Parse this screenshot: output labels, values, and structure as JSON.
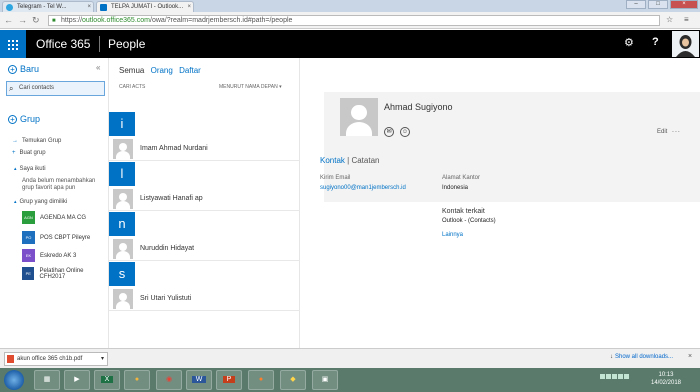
{
  "browser": {
    "tabs": [
      {
        "title": "Telegram - Tel W..."
      },
      {
        "title": "TELPA JUMATI - Outlook..."
      }
    ],
    "url_prefix": "https://",
    "url_host": "outlook.office365.com",
    "url_path": "/owa/?realm=madrjembersch.id#path=/people",
    "window_controls": {
      "minimize": "–",
      "maximize": "□",
      "close": "×"
    }
  },
  "o365": {
    "brand": "Office 365",
    "app": "People"
  },
  "leftnav": {
    "new_label": "Baru",
    "search_placeholder": "Cari contacts",
    "group_header": "Grup",
    "discover_groups": "Temukan Grup",
    "create_group": "Buat grup",
    "i_joined_header": "Saya ikuti",
    "hint": "Anda belum menambahkan grup favorit apa pun",
    "owned_header": "Grup yang dimiliki",
    "groups": [
      {
        "initials": "AGN",
        "name": "AGENDA MA CG",
        "color": "#2a9d3c"
      },
      {
        "initials": "PO",
        "name": "POS CBPT Pileyre",
        "color": "#1f6fbf"
      },
      {
        "initials": "EK",
        "name": "Eskredo AK 3",
        "color": "#7a4fc9"
      },
      {
        "initials": "PE",
        "name": "Pelatihan Online CFH2017",
        "color": "#1f4f8f"
      }
    ]
  },
  "list": {
    "filters": [
      "Semua",
      "Orang",
      "Daftar"
    ],
    "selected_filter": "Semua",
    "sub_left": "CARI ACTS",
    "sub_right": "MENURUT NAMA DEPAN",
    "rows": [
      {
        "kind": "letter",
        "text": "i"
      },
      {
        "kind": "contact",
        "name": "Imam Ahmad Nurdani"
      },
      {
        "kind": "letter",
        "text": "l"
      },
      {
        "kind": "contact",
        "name": "Listyawati Hanafi ap"
      },
      {
        "kind": "letter",
        "text": "n"
      },
      {
        "kind": "contact",
        "name": "Nuruddin Hidayat"
      },
      {
        "kind": "letter",
        "text": "s"
      },
      {
        "kind": "contact",
        "name": "Sri Utari Yulistuti"
      }
    ]
  },
  "detail": {
    "name": "Ahmad Sugiyono",
    "tabs": [
      "Kontak",
      "Catatan"
    ],
    "edit_label": "Edit",
    "more_label": "...",
    "email_label": "Kirim Email",
    "email_value": "sugiyono00@man1jembersch.id",
    "office_label": "Alamat Kantor",
    "office_value": "Indonesia",
    "related_label": "Kontak terkait",
    "related_value": "Outlook - (Contacts)",
    "more_link": "Lainnya"
  },
  "downloads": {
    "file": "akun office 365 ch1b.pdf",
    "show_all": "Show all downloads...",
    "close": "×"
  },
  "taskbar": {
    "apps": [
      "X",
      "",
      "",
      "W",
      "P",
      "",
      "",
      ""
    ],
    "time": "10:13",
    "date": "14/02/2018"
  }
}
